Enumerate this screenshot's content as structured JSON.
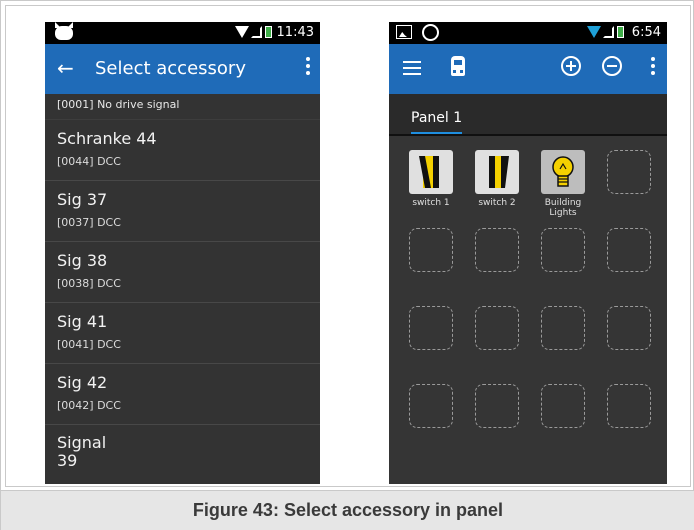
{
  "caption": "Figure 43: Select accessory in panel",
  "left_screen": {
    "status_time": "11:43",
    "title": "Select accessory",
    "first_item": "[0001]  No drive signal",
    "items": [
      {
        "name": "Schranke 44",
        "sub": "[0044]  DCC"
      },
      {
        "name": "Sig 37",
        "sub": "[0037]  DCC"
      },
      {
        "name": "Sig 38",
        "sub": "[0038]  DCC"
      },
      {
        "name": "Sig 41",
        "sub": "[0041]  DCC"
      },
      {
        "name": "Sig 42",
        "sub": "[0042]  DCC"
      }
    ],
    "last_item_line1": "Signal",
    "last_item_line2": "39"
  },
  "right_screen": {
    "status_time": "6:54",
    "tab": "Panel 1",
    "tiles": [
      {
        "label": "switch 1",
        "icon": "switch-straight-icon"
      },
      {
        "label": "switch 2",
        "icon": "switch-diverge-icon"
      },
      {
        "label": "Building Lights",
        "icon": "light-bulb-icon"
      }
    ]
  },
  "colors": {
    "appbar": "#1f6bb8",
    "background_dark": "#333333",
    "accent_tab": "#1f8fe0",
    "tile_yellow": "#f4d000"
  }
}
